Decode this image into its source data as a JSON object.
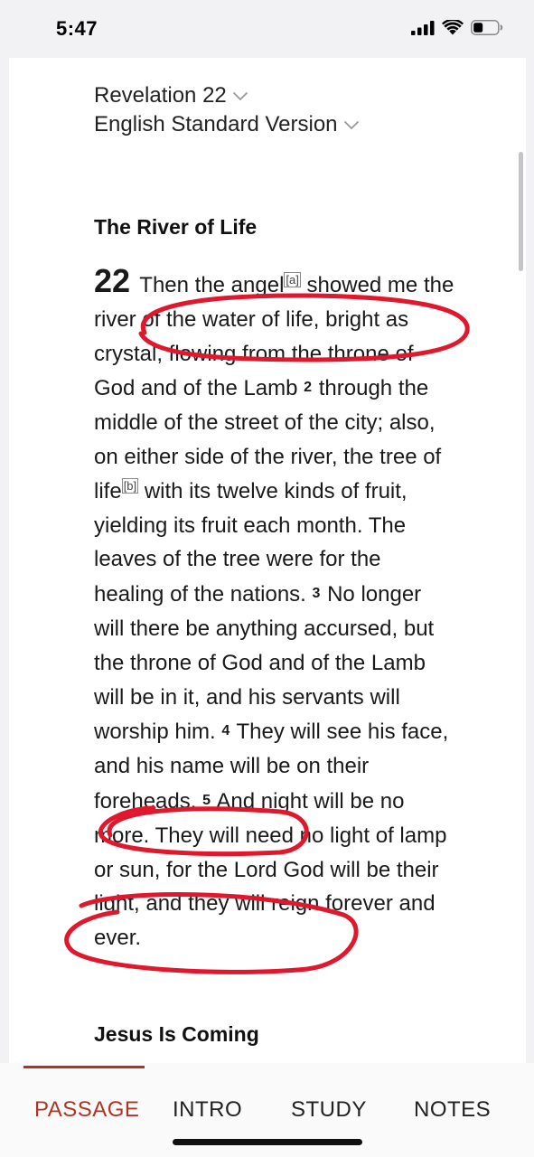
{
  "status_bar": {
    "time": "5:47",
    "icons": [
      "signal-icon",
      "wifi-icon",
      "battery-icon"
    ]
  },
  "selector": {
    "book_chapter": "Revelation 22",
    "version": "English Standard Version"
  },
  "passage": {
    "heading_1": "The River of Life",
    "chapter_number": "22",
    "v1": "Then the angel",
    "fn_a": "[a]",
    "v1b": " showed me the river of the water of life, bright as crystal, flowing from the throne of God and of the Lamb ",
    "v2_num": "2",
    "v2a": " through the middle of the street of the city; also, on either side of the river, the tree of life",
    "fn_b": "[b]",
    "v2b": " with its twelve kinds of fruit, yielding its fruit each month. The leaves of the tree were for the healing of the nations. ",
    "v3_num": "3",
    "v3": " No longer will there be anything accursed, but the throne of God and of the Lamb will be in it, and his servants will worship him. ",
    "v4_num": "4",
    "v4": " They will see his face, and his name will be on their foreheads. ",
    "v5_num": "5",
    "v5": " And night will be no more. They will need no light of lamp or sun, for the Lord God will be their light, and they will reign forever and ever.",
    "heading_2": "Jesus Is Coming"
  },
  "colors": {
    "accent": "#b03424",
    "annotation": "#e0182e"
  },
  "tabs": [
    {
      "label": "PASSAGE",
      "active": true
    },
    {
      "label": "INTRO",
      "active": false
    },
    {
      "label": "STUDY",
      "active": false
    },
    {
      "label": "NOTES",
      "active": false
    }
  ]
}
